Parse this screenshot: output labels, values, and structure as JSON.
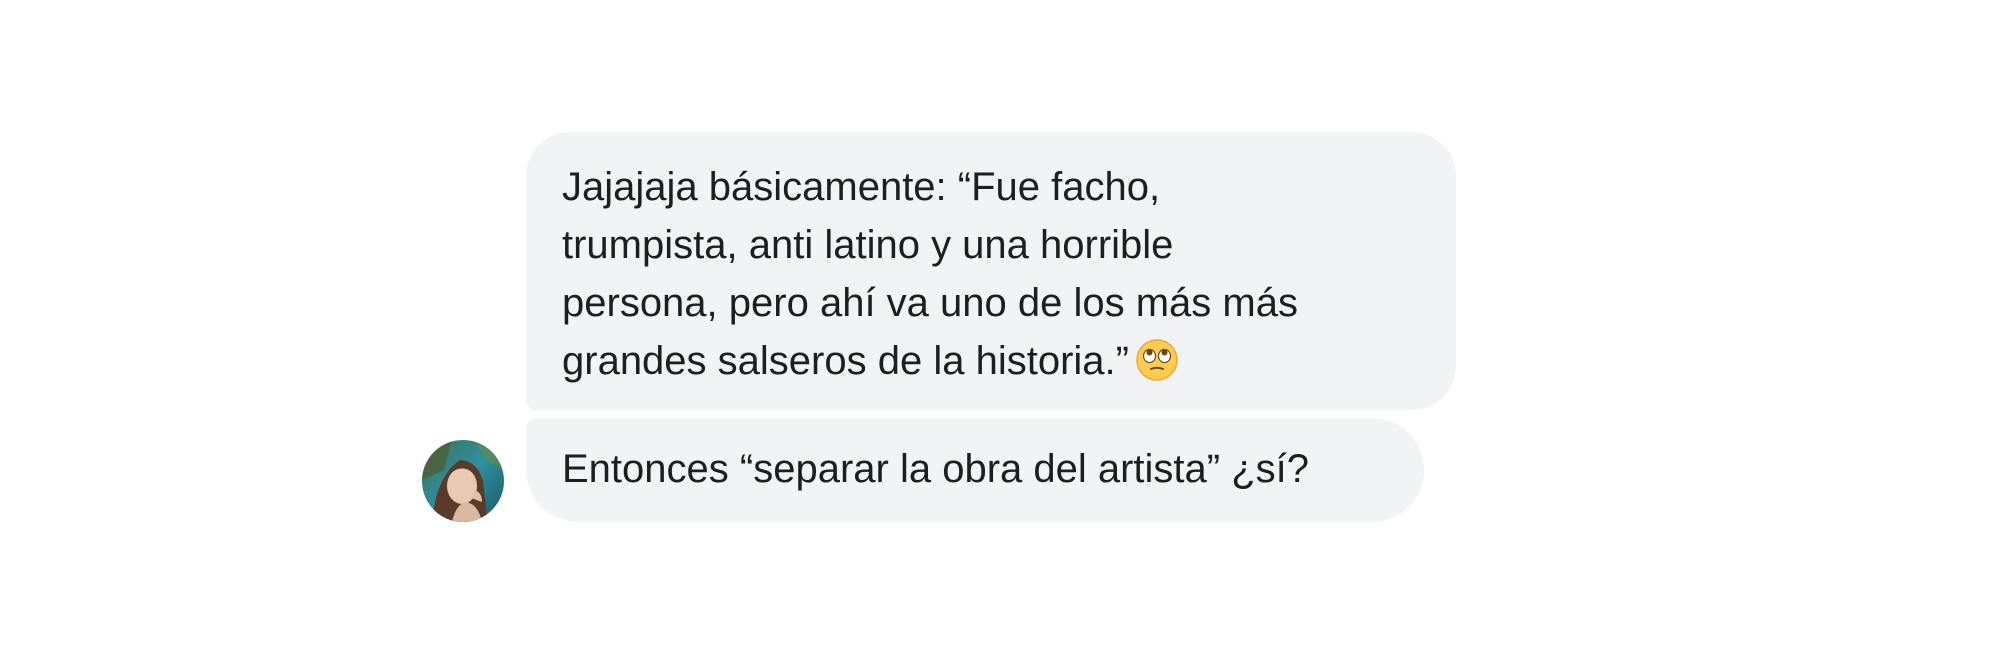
{
  "conversation": {
    "messages": [
      {
        "text": "Jajajaja básicamente: “Fue facho,\ntrumpista, anti latino y una horrible\npersona, pero ahí va uno de los más más\ngrandes salseros de la historia.”",
        "emoji": "face-with-rolling-eyes"
      },
      {
        "text": "Entonces “separar la obra del artista” ¿sí?"
      }
    ],
    "avatar": {
      "name": "sender-avatar"
    }
  },
  "colors": {
    "bubble_background": "#f2f3f5",
    "text": "#1c1e21",
    "page_background": "#ffffff"
  }
}
